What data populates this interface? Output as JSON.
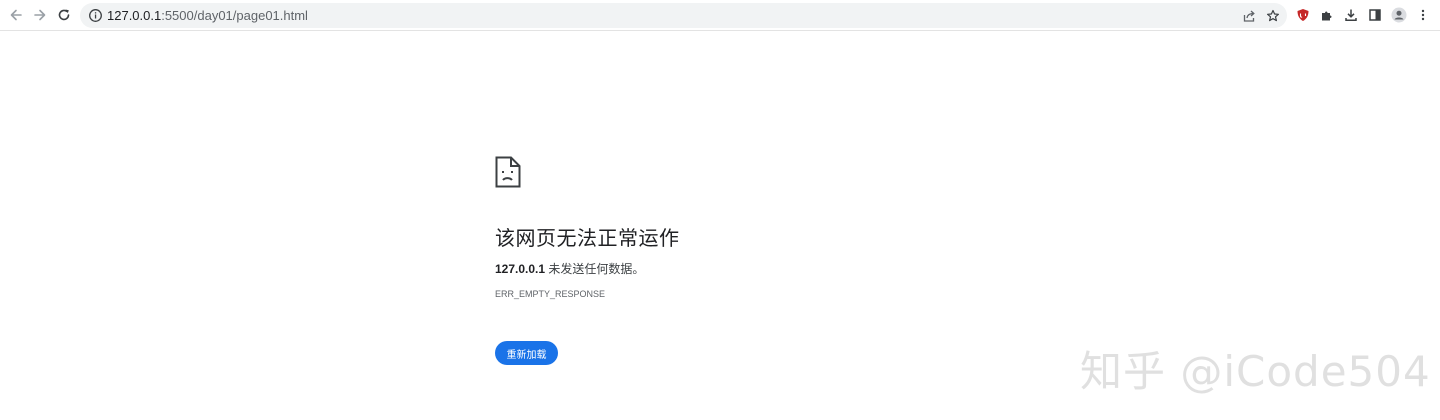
{
  "toolbar": {
    "url_host": "127.0.0.1",
    "url_rest": ":5500/day01/page01.html"
  },
  "error": {
    "title": "该网页无法正常运作",
    "host": "127.0.0.1",
    "message": " 未发送任何数据。",
    "code": "ERR_EMPTY_RESPONSE",
    "reload_label": "重新加载"
  },
  "watermark": "知乎 @iCode504",
  "colors": {
    "accent": "#1a73e8",
    "extension_red": "#c62828"
  }
}
